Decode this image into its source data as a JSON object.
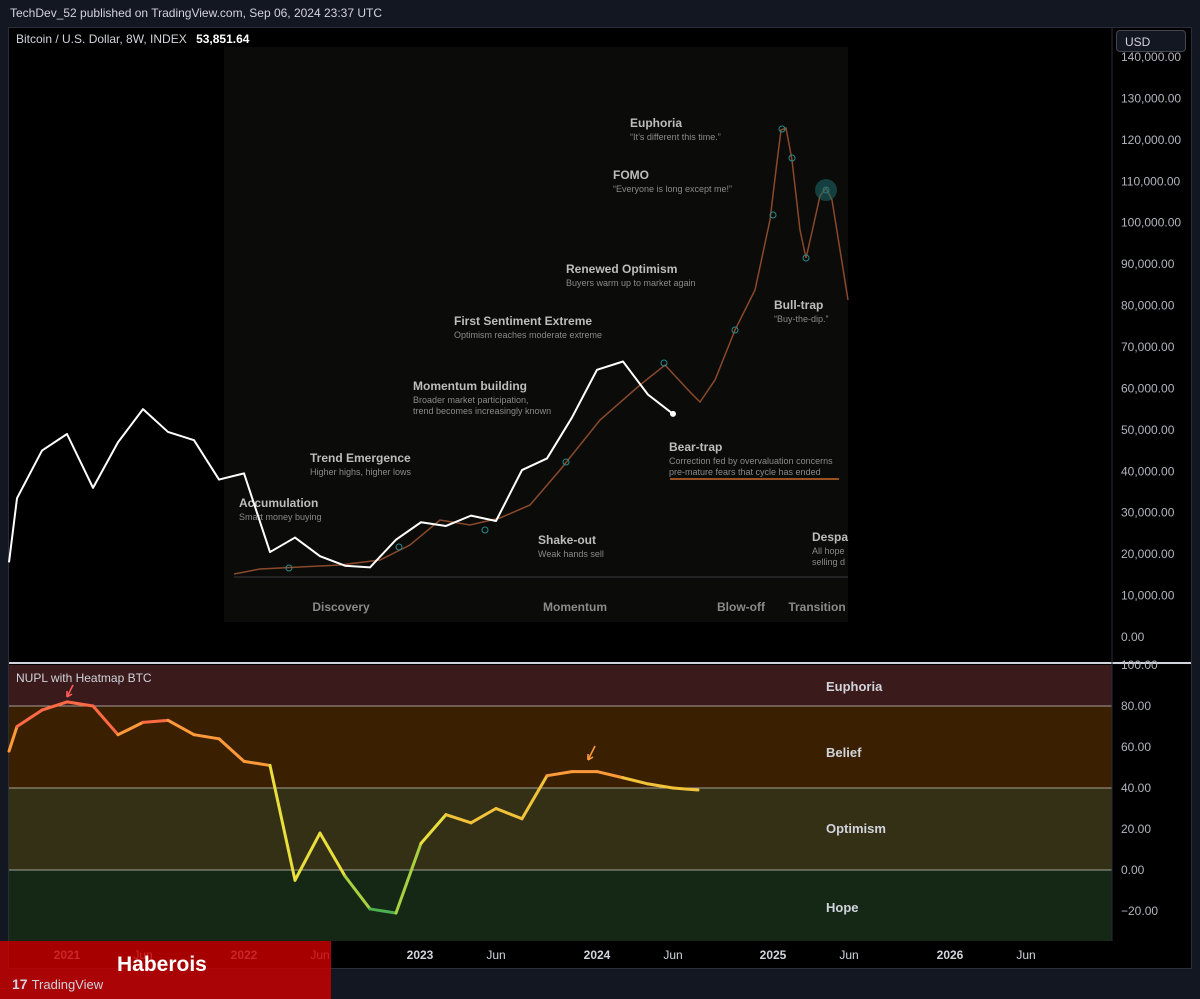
{
  "header": {
    "published_text": "TechDev_52 published on TradingView.com, Sep 06, 2024 23:37 UTC"
  },
  "main_pane": {
    "symbol_text": "Bitcoin / U.S. Dollar, 8W, INDEX",
    "last_price": "53,851.64",
    "currency_button": "USD",
    "y_ticks": [
      "140,000.00",
      "130,000.00",
      "120,000.00",
      "110,000.00",
      "100,000.00",
      "90,000.00",
      "80,000.00",
      "70,000.00",
      "60,000.00",
      "50,000.00",
      "40,000.00",
      "30,000.00",
      "20,000.00",
      "10,000.00",
      "0.00"
    ],
    "overlay": {
      "annotations": [
        {
          "title": "Euphoria",
          "sub": [
            "“It’s different this time.”"
          ]
        },
        {
          "title": "FOMO",
          "sub": [
            "“Everyone is long except me!”"
          ]
        },
        {
          "title": "Renewed Optimism",
          "sub": [
            "Buyers warm up to market again"
          ]
        },
        {
          "title": "First Sentiment Extreme",
          "sub": [
            "Optimism reaches moderate extreme"
          ]
        },
        {
          "title": "Momentum building",
          "sub": [
            "Broader market participation,",
            "trend becomes increasingly known"
          ]
        },
        {
          "title": "Trend Emergence",
          "sub": [
            "Higher highs, higher lows"
          ]
        },
        {
          "title": "Accumulation",
          "sub": [
            "Smart money buying"
          ]
        },
        {
          "title": "Shake-out",
          "sub": [
            "Weak hands sell"
          ]
        },
        {
          "title": "Bear-trap",
          "sub": [
            "Correction fed by overvaluation concerns",
            "pre-mature fears that cycle has ended"
          ]
        },
        {
          "title": "Bull-trap",
          "sub": [
            "“Buy-the-dip.”"
          ]
        },
        {
          "title": "Despa",
          "sub": [
            "All hope",
            "selling d"
          ]
        }
      ],
      "phases": [
        "Discovery",
        "Momentum",
        "Blow-off",
        "Transition"
      ]
    }
  },
  "sub_pane": {
    "title": "NUPL with Heatmap BTC",
    "zones": [
      "Euphoria",
      "Belief",
      "Optimism",
      "Hope"
    ],
    "y_ticks": [
      "100.00",
      "80.00",
      "60.00",
      "40.00",
      "20.00",
      "0.00",
      "−20.00"
    ],
    "colors": {
      "euphoria": "#3a1a1a",
      "belief": "#3a2000",
      "optimism": "#333015",
      "hope": "#152815"
    }
  },
  "x_axis": {
    "labels": [
      "2021",
      "Jun",
      "2022",
      "Jun",
      "2023",
      "Jun",
      "2024",
      "Jun",
      "2025",
      "Jun",
      "2026",
      "Jun"
    ]
  },
  "watermark": {
    "text": "Haberois"
  },
  "footer": {
    "logo_text": "TradingView"
  },
  "chart_data": [
    {
      "type": "line",
      "title": "Bitcoin / U.S. Dollar, 8W, INDEX",
      "x": [
        "2020-11",
        "2021-01",
        "2021-03",
        "2021-05",
        "2021-07",
        "2021-09",
        "2021-11",
        "2022-01",
        "2022-03",
        "2022-05",
        "2022-07",
        "2022-09",
        "2022-11",
        "2023-01",
        "2023-03",
        "2023-05",
        "2023-07",
        "2023-09",
        "2023-11",
        "2024-01",
        "2024-03",
        "2024-05",
        "2024-07",
        "2024-09"
      ],
      "y": [
        18000,
        33500,
        45000,
        49000,
        36000,
        47000,
        55000,
        49500,
        47500,
        38000,
        39500,
        20500,
        24000,
        19500,
        17200,
        16800,
        23500,
        27700,
        26800,
        29300,
        28000,
        40300,
        43100,
        53000,
        64500,
        66500,
        58500,
        53851
      ],
      "series": [
        {
          "name": "BTCUSD",
          "values": [
            18000,
            33500,
            45000,
            49000,
            36000,
            47000,
            55000,
            49500,
            47500,
            38000,
            39500,
            20500,
            24000,
            19500,
            17200,
            16800,
            23500,
            27700,
            26800,
            29300,
            28000,
            40300,
            43100,
            53000,
            64500,
            66500,
            58500,
            53851
          ]
        }
      ],
      "ylim": [
        0,
        140000
      ]
    },
    {
      "type": "line",
      "title": "NUPL with Heatmap BTC",
      "series": [
        {
          "name": "NUPL",
          "values": [
            58,
            70,
            78,
            82,
            80,
            66,
            72,
            73,
            66,
            64,
            53,
            51,
            -5,
            18,
            -3,
            -19,
            -21,
            13,
            27,
            23,
            30,
            25,
            46,
            48,
            48,
            45,
            42,
            40,
            39
          ]
        }
      ],
      "ylim": [
        -35,
        100
      ]
    }
  ]
}
